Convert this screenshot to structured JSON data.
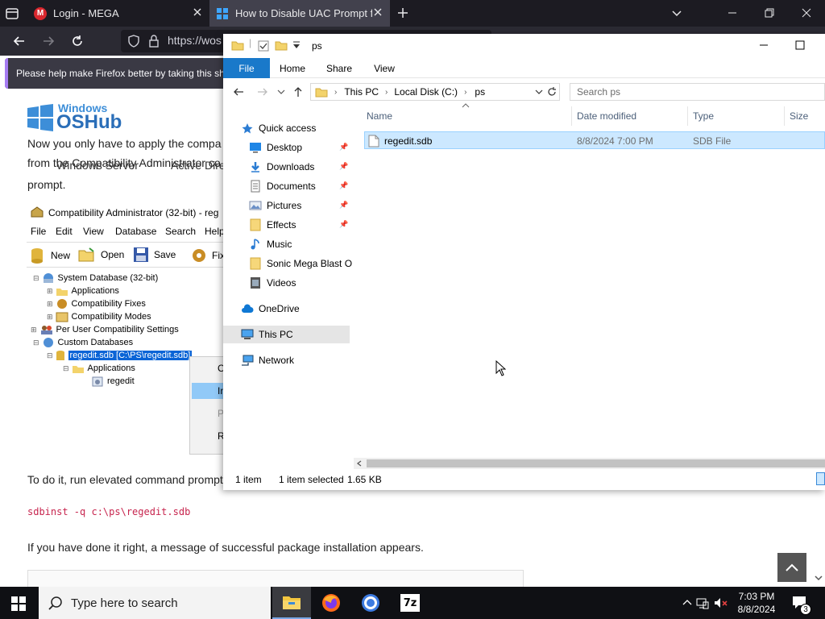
{
  "browser": {
    "tabs": [
      {
        "title": "Login - MEGA",
        "favicon": "M"
      },
      {
        "title": "How to Disable UAC Prompt for"
      }
    ],
    "url": "https://wos",
    "notification": "Please help make Firefox better by taking this sho"
  },
  "page": {
    "logo_line1": "Windows",
    "logo_line2": "OSHub",
    "nav": [
      "Windows Server",
      "Active Dire"
    ],
    "intro_line1": "Now you only have to apply the compa",
    "intro_line2": "from the Compatibility Administrator co",
    "intro_line3": "prompt.",
    "run_text": "To do it, run elevated command prompt",
    "code": "sdbinst -q c:\\ps\\regedit.sdb",
    "success_text": "If you have done it right, a message of successful package installation appears."
  },
  "compat": {
    "title": "Compatibility Administrator (32-bit) - reg",
    "menu": [
      "File",
      "Edit",
      "View",
      "Database",
      "Search",
      "Help"
    ],
    "toolbar": [
      "New",
      "Open",
      "Save",
      "Fix"
    ],
    "tree": [
      {
        "label": "System Database (32-bit)",
        "level": 0
      },
      {
        "label": "Applications",
        "level": 1
      },
      {
        "label": "Compatibility Fixes",
        "level": 1
      },
      {
        "label": "Compatibility Modes",
        "level": 1
      },
      {
        "label": "Per User Compatibility Settings",
        "level": 0
      },
      {
        "label": "Custom Databases",
        "level": 0
      },
      {
        "label": "regedit.sdb [C:\\PS\\regedit.sdb]",
        "level": 1,
        "selected": true
      },
      {
        "label": "Applications",
        "level": 2
      },
      {
        "label": "regedit",
        "level": 3
      }
    ],
    "context_menu": [
      "C",
      "In",
      "P",
      "R"
    ]
  },
  "explorer": {
    "title": "ps",
    "ribbon_tabs": [
      "File",
      "Home",
      "Share",
      "View"
    ],
    "breadcrumb": [
      "This PC",
      "Local Disk (C:)",
      "ps"
    ],
    "search_placeholder": "Search ps",
    "columns": [
      "Name",
      "Date modified",
      "Type",
      "Size"
    ],
    "nav": [
      {
        "label": "Quick access",
        "icon": "star-icon"
      },
      {
        "label": "Desktop",
        "icon": "desktop-icon",
        "pinned": true
      },
      {
        "label": "Downloads",
        "icon": "download-icon",
        "pinned": true
      },
      {
        "label": "Documents",
        "icon": "document-icon",
        "pinned": true
      },
      {
        "label": "Pictures",
        "icon": "picture-icon",
        "pinned": true
      },
      {
        "label": "Effects",
        "icon": "folder-icon",
        "pinned": true
      },
      {
        "label": "Music",
        "icon": "music-icon"
      },
      {
        "label": "Sonic Mega Blast O",
        "icon": "folder-icon"
      },
      {
        "label": "Videos",
        "icon": "video-icon"
      },
      {
        "label": "OneDrive",
        "icon": "cloud-icon"
      },
      {
        "label": "This PC",
        "icon": "computer-icon",
        "selected": true
      },
      {
        "label": "Network",
        "icon": "network-icon"
      }
    ],
    "files": [
      {
        "name": "regedit.sdb",
        "date": "8/8/2024 7:00 PM",
        "type": "SDB File",
        "size": ""
      }
    ],
    "status_count": "1 item",
    "status_selected": "1 item selected",
    "status_size": "1.65 KB"
  },
  "taskbar": {
    "search_placeholder": "Type here to search",
    "time": "7:03 PM",
    "date": "8/8/2024",
    "notifications": "3",
    "apps": [
      "file-explorer",
      "firefox",
      "chrome",
      "7zip"
    ],
    "seven_zip_label": "7z"
  },
  "colors": {
    "accent": "#1979ca",
    "selection": "#cce8ff",
    "firefox_dark": "#1c1b22",
    "taskbar": "#0f1014"
  }
}
